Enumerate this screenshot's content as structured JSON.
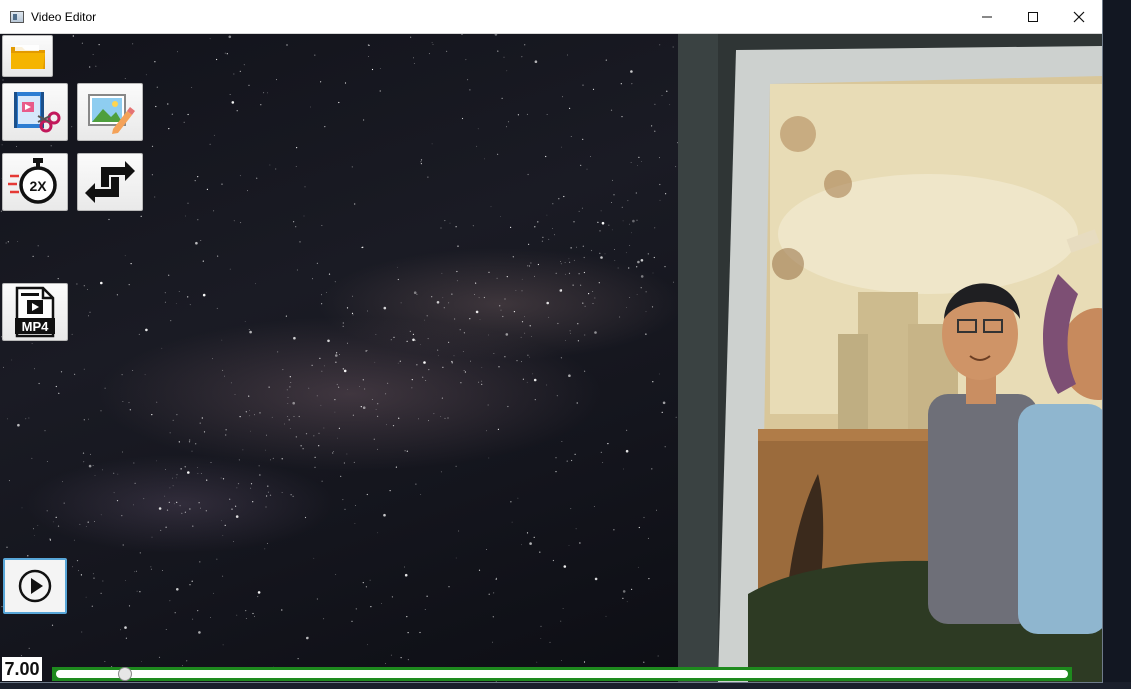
{
  "window": {
    "title": "Video Editor",
    "controls": {
      "minimize": "—",
      "maximize": "☐",
      "close": "✕"
    }
  },
  "toolbar": {
    "tools": [
      {
        "name": "open-folder-button",
        "icon": "folder-icon"
      },
      {
        "name": "cut-video-button",
        "icon": "film-scissors-icon"
      },
      {
        "name": "edit-image-button",
        "icon": "image-pencil-icon"
      },
      {
        "name": "speed-button",
        "icon": "stopwatch-2x-icon",
        "label": "2X"
      },
      {
        "name": "swap-button",
        "icon": "swap-arrows-icon"
      },
      {
        "name": "export-mp4-button",
        "icon": "mp4-file-icon",
        "label": "MP4"
      },
      {
        "name": "play-button",
        "icon": "play-icon"
      }
    ]
  },
  "playback": {
    "time": "7.00",
    "progress": 0.068
  },
  "colors": {
    "timeline_border": "#1e8a1e",
    "play_border": "#58a6d8",
    "folder": "#f5b400"
  }
}
